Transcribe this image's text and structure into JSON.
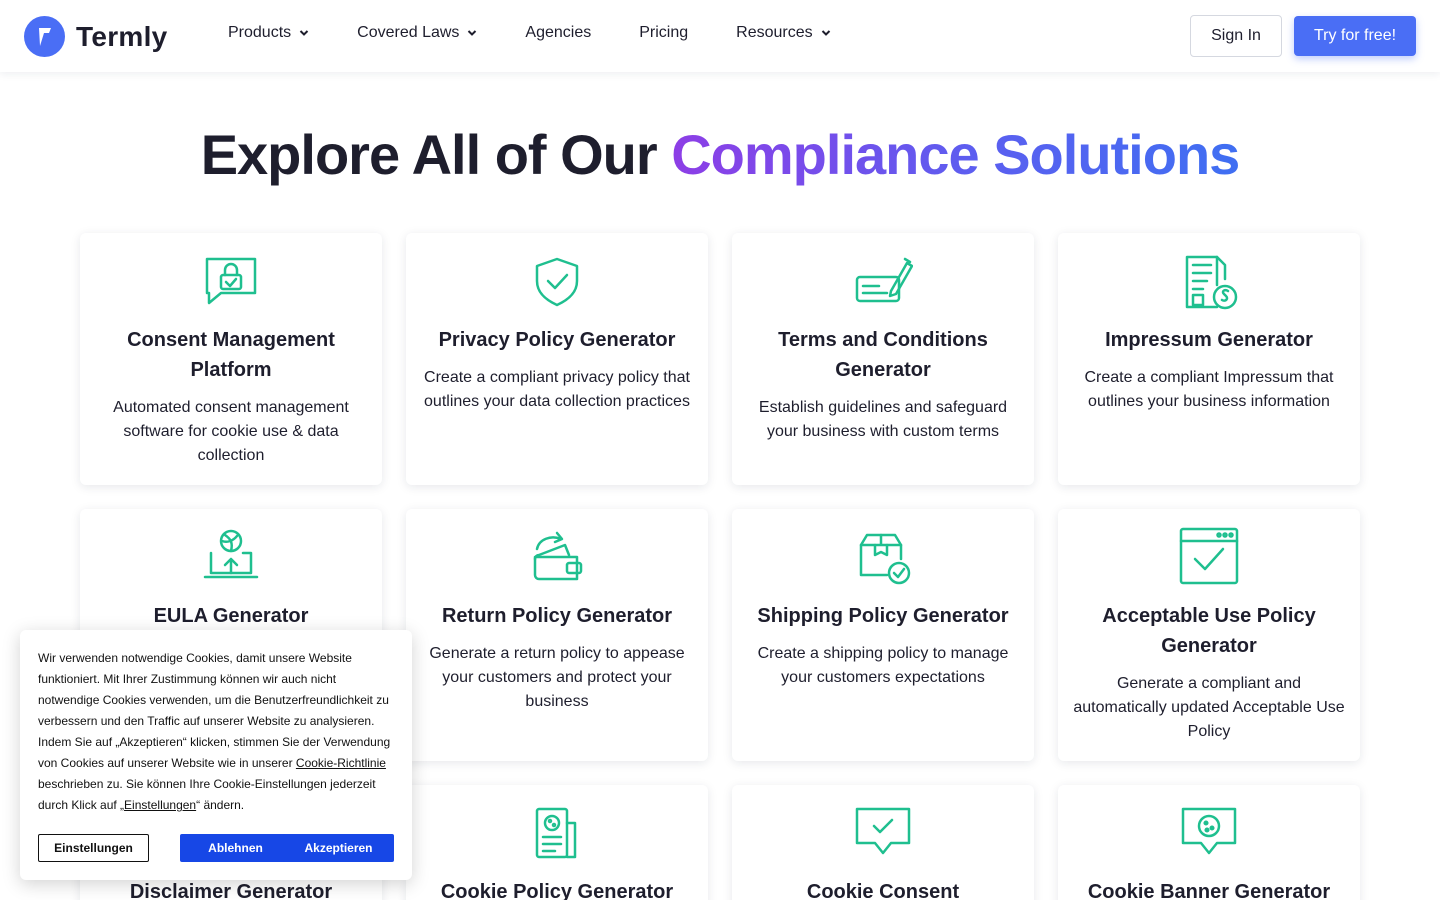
{
  "brand": {
    "name": "Termly",
    "accent": "#4a6ef5",
    "icon_color": "#1fbf8f"
  },
  "nav": {
    "items": [
      {
        "label": "Products",
        "dropdown": true
      },
      {
        "label": "Covered Laws",
        "dropdown": true
      },
      {
        "label": "Agencies",
        "dropdown": false
      },
      {
        "label": "Pricing",
        "dropdown": false
      },
      {
        "label": "Resources",
        "dropdown": true
      }
    ],
    "sign_in": "Sign In",
    "try_free": "Try for free!"
  },
  "hero": {
    "title_plain": "Explore All of Our ",
    "title_highlight": "Compliance Solutions"
  },
  "cards": [
    {
      "icon": "chat-lock-icon",
      "title": "Consent Management Platform",
      "desc": "Automated consent management software for cookie use & data collection"
    },
    {
      "icon": "shield-check-icon",
      "title": "Privacy Policy Generator",
      "desc": "Create a compliant privacy policy that outlines your data collection practices"
    },
    {
      "icon": "signature-pen-icon",
      "title": "Terms and Conditions Generator",
      "desc": "Establish guidelines and safeguard your business with custom terms"
    },
    {
      "icon": "document-section-icon",
      "title": "Impressum Generator",
      "desc": "Create a compliant Impressum that outlines your business information"
    },
    {
      "icon": "laptop-upload-icon",
      "title": "EULA Generator",
      "desc": ""
    },
    {
      "icon": "wallet-return-icon",
      "title": "Return Policy Generator",
      "desc": "Generate a return policy to appease your customers and protect your business"
    },
    {
      "icon": "box-check-icon",
      "title": "Shipping Policy Generator",
      "desc": "Create a shipping policy to manage your customers expectations"
    },
    {
      "icon": "browser-check-icon",
      "title": "Acceptable Use Policy Generator",
      "desc": "Generate a compliant and automatically updated Acceptable Use Policy"
    },
    {
      "icon": "",
      "title": "Disclaimer Generator",
      "desc": ""
    },
    {
      "icon": "cookie-document-icon",
      "title": "Cookie Policy Generator",
      "desc": ""
    },
    {
      "icon": "chat-check-icon",
      "title": "Cookie Consent",
      "desc": ""
    },
    {
      "icon": "cookie-chat-icon",
      "title": "Cookie Banner Generator",
      "desc": ""
    }
  ],
  "cookie_banner": {
    "text_before_link1": "Wir verwenden notwendige Cookies, damit unsere Website funktioniert. Mit Ihrer Zustimmung können wir auch nicht notwendige Cookies verwenden, um die Benutzerfreundlichkeit zu verbessern und den Traffic auf unserer Website zu analysieren. Indem Sie auf „Akzeptieren“ klicken, stimmen Sie der Verwendung von Cookies auf unserer Website wie in unserer ",
    "link1": "Cookie-Richtlinie",
    "text_between": " beschrieben zu. Sie können Ihre Cookie-Einstellungen jederzeit durch Klick auf „",
    "link2": "Einstellungen",
    "text_after": "“ ändern.",
    "settings_label": "Einstellungen",
    "decline_label": "Ablehnen",
    "accept_label": "Akzeptieren"
  }
}
